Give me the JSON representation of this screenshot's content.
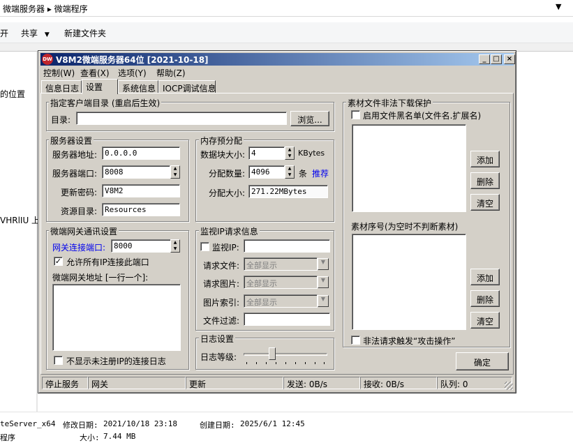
{
  "explorer": {
    "address": "微端服务器 ▸ 微端程序",
    "toolbar": {
      "open": "开",
      "share": "共享",
      "new_folder": "新建文件夹"
    },
    "left": {
      "location": "的位置",
      "item": "VHRlIU 上"
    },
    "footer": {
      "name": "teServer_x64",
      "modified_label": "修改日期:",
      "modified": "2021/10/18 23:18",
      "created_label": "创建日期:",
      "created": "2025/6/1 12:45",
      "type": "程序",
      "size_label": "大小:",
      "size": "7.44 MB"
    }
  },
  "window": {
    "title": "V8M2微端服务器64位 [2021-10-18]",
    "icon": "app-logo-icon",
    "menu": [
      "控制(W)",
      "查看(X)",
      "选项(Y)",
      "帮助(Z)"
    ],
    "tabs": [
      "信息日志",
      "设置",
      "系统信息",
      "IOCP调试信息"
    ],
    "active_tab": 1
  },
  "settings": {
    "client_dir": {
      "title": "指定客户端目录 (重启后生效)",
      "label": "目录:",
      "value": "",
      "browse": "浏览..."
    },
    "server": {
      "title": "服务器设置",
      "address_label": "服务器地址:",
      "address": "0.0.0.0",
      "port_label": "服务器端口:",
      "port": "8008",
      "password_label": "更新密码:",
      "password": "V8M2",
      "resource_label": "资源目录:",
      "resource": "Resources"
    },
    "memory": {
      "title": "内存预分配",
      "block_label": "数据块大小:",
      "block": "4",
      "block_unit": "KBytes",
      "count_label": "分配数量:",
      "count": "4096",
      "count_unit": "条",
      "recommend": "推荐",
      "size_label": "分配大小:",
      "size": "271.22MBytes"
    },
    "gateway": {
      "title": "微端网关通讯设置",
      "port_label": "网关连接端口:",
      "port": "8000",
      "allow_label": "允许所有IP连接此端口",
      "addr_label": "微端网关地址 [一行一个]:",
      "hide_log_label": "不显示未注册IP的连接日志"
    },
    "monitor": {
      "title": "监视IP请求信息",
      "ip_label": "监视IP:",
      "ip": "",
      "file_label": "请求文件:",
      "file": "全部显示",
      "image_label": "请求图片:",
      "image": "全部显示",
      "index_label": "图片索引:",
      "index": "全部显示",
      "filter_label": "文件过滤:",
      "filter": ""
    },
    "log": {
      "title": "日志设置",
      "level_label": "日志等级:",
      "level": 0.33
    },
    "protect": {
      "title": "素材文件非法下载保护",
      "blacklist_label": "启用文件黑名单(文件名.扩展名)",
      "serial_label": "素材序号(为空时不判断素材)",
      "add": "添加",
      "delete": "删除",
      "clear": "清空",
      "attack_label": "非法请求触发“攻击操作”"
    },
    "ok": "确定"
  },
  "status": {
    "stop": "停止服务",
    "gateway": "网关",
    "update": "更新",
    "send": "发送: 0B/s",
    "recv": "接收: 0B/s",
    "queue": "队列: 0"
  }
}
